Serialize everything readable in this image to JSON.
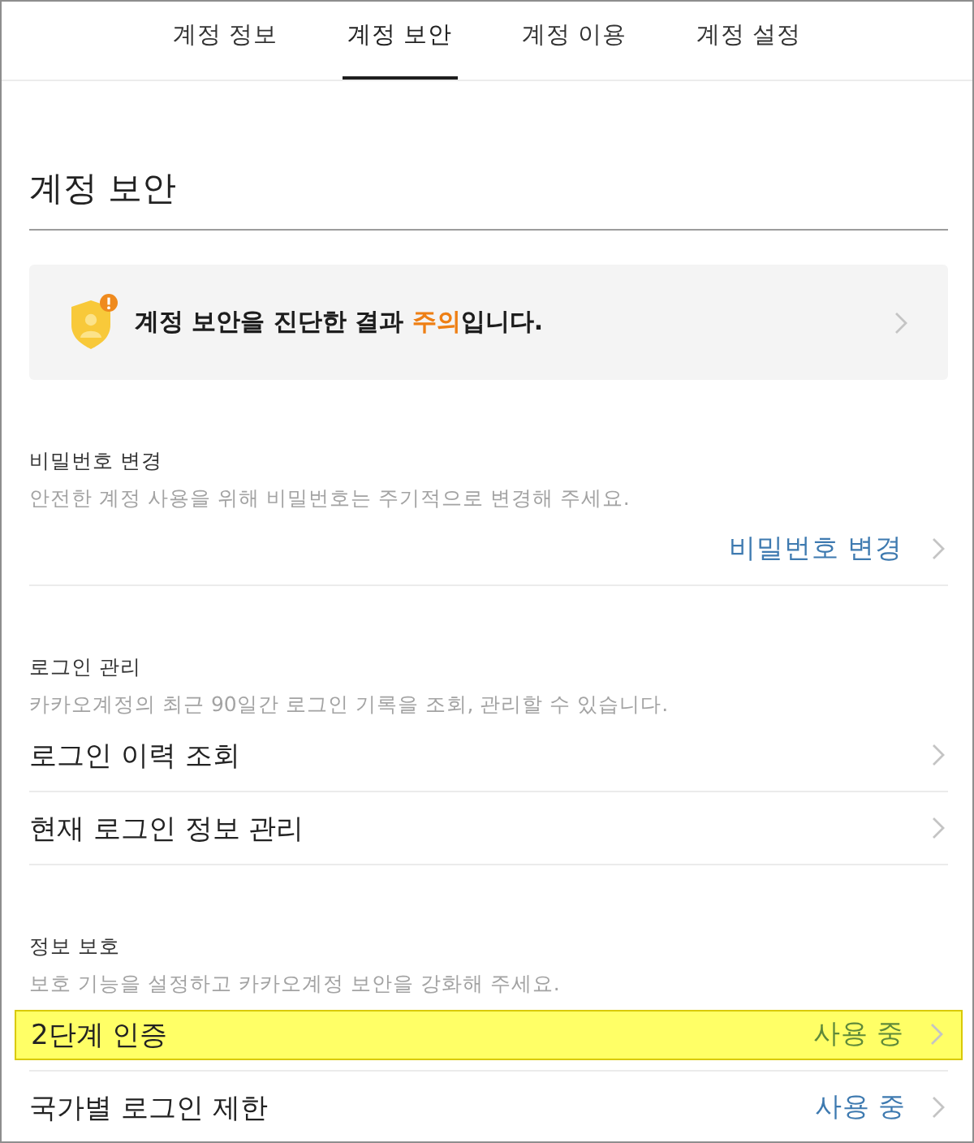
{
  "tabs": [
    {
      "label": "계정 정보",
      "selected": false
    },
    {
      "label": "계정 보안",
      "selected": true
    },
    {
      "label": "계정 이용",
      "selected": false
    },
    {
      "label": "계정 설정",
      "selected": false
    }
  ],
  "page_title": "계정 보안",
  "alert": {
    "message": [
      {
        "kind": "plain",
        "text": "계정 보안을 진단한 결과 "
      },
      {
        "kind": "warning",
        "text": "주의"
      },
      {
        "kind": "plain",
        "text": "입니다."
      }
    ]
  },
  "sections": [
    {
      "heading": "비밀번호 변경",
      "description": "안전한 계정 사용을 위해 비밀번호는 주기적으로 변경해 주세요.",
      "items": [
        {
          "kind": "link",
          "label": "비밀번호 변경"
        }
      ]
    },
    {
      "heading": "로그인 관리",
      "description": "카카오계정의 최근 90일간 로그인 기록을 조회, 관리할 수 있습니다.",
      "items": [
        {
          "kind": "row",
          "label": "로그인 이력 조회",
          "highlighted": false
        },
        {
          "kind": "row",
          "label": "현재 로그인 정보 관리",
          "highlighted": false
        }
      ]
    },
    {
      "heading": "정보 보호",
      "description": "보호 기능을 설정하고 카카오계정 보안을 강화해 주세요.",
      "items": [
        {
          "kind": "row",
          "label": "2단계 인증",
          "status": "사용 중",
          "highlighted": true
        },
        {
          "kind": "row",
          "label": "국가별 로그인 제한",
          "status": "사용 중",
          "highlighted": false
        }
      ]
    }
  ]
}
